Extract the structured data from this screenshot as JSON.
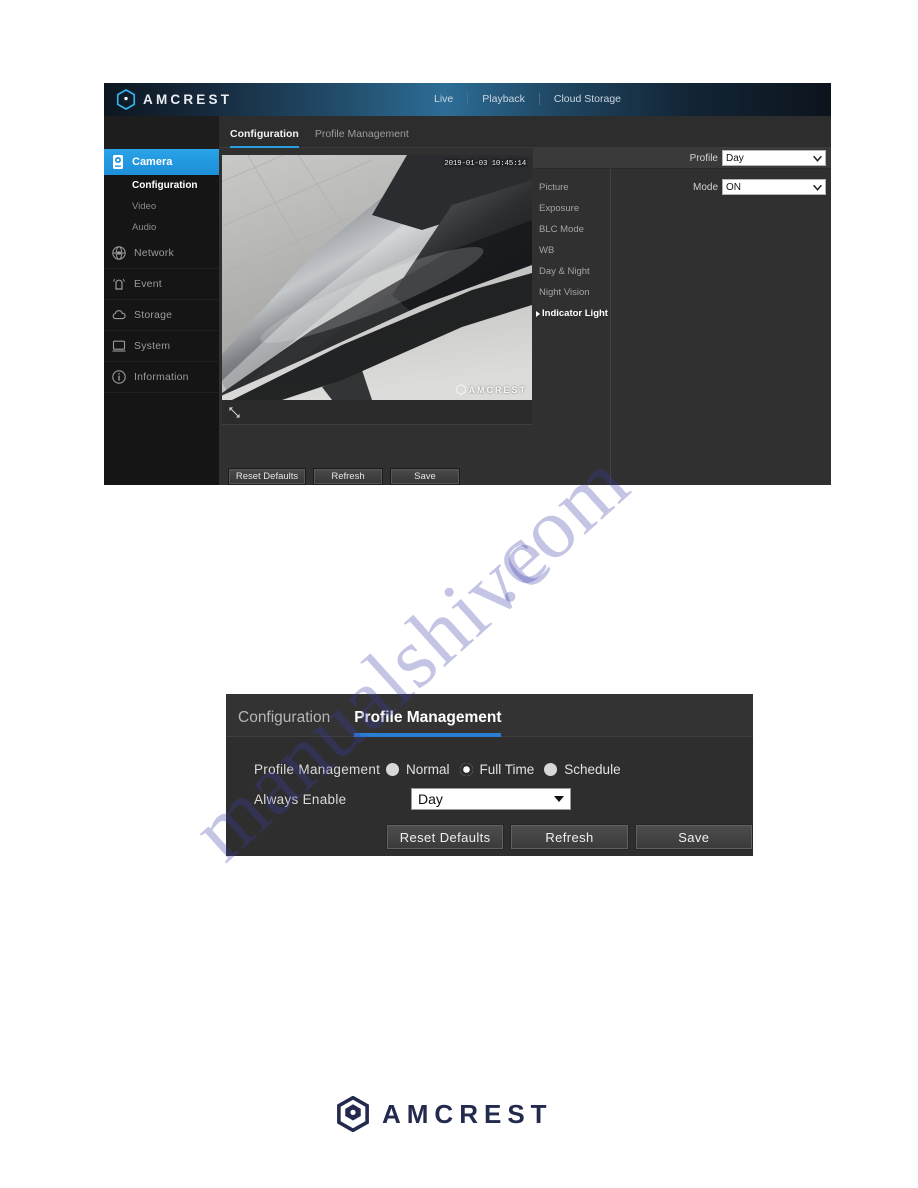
{
  "figure1": {
    "brand": "AMCREST",
    "brand_icon": "amcrest-hex-logo-icon",
    "topnav": [
      {
        "label": "Live"
      },
      {
        "label": "Playback"
      },
      {
        "label": "Cloud Storage"
      }
    ],
    "sidebar": {
      "active": {
        "label": "Camera",
        "icon": "camera-icon"
      },
      "sub_items": [
        {
          "label": "Configuration",
          "current": true
        },
        {
          "label": "Video",
          "current": false
        },
        {
          "label": "Audio",
          "current": false
        }
      ],
      "items": [
        {
          "label": "Network",
          "icon": "globe-network-icon"
        },
        {
          "label": "Event",
          "icon": "alarm-bell-icon"
        },
        {
          "label": "Storage",
          "icon": "cloud-storage-icon"
        },
        {
          "label": "System",
          "icon": "monitor-system-icon"
        },
        {
          "label": "Information",
          "icon": "info-circle-icon"
        }
      ]
    },
    "tabs": [
      {
        "label": "Configuration",
        "active": true
      },
      {
        "label": "Profile Management",
        "active": false
      }
    ],
    "video": {
      "timestamp": "2019-01-03 10:45:14",
      "overlay_logo": "AMCREST",
      "overlay_logo_icon": "amcrest-hex-logo-icon",
      "expand_icon": "expand-fullscreen-icon"
    },
    "profile_field": {
      "label": "Profile",
      "value": "Day",
      "icon": "chevron-down-icon"
    },
    "sub_menu": [
      {
        "label": "Picture",
        "selected": false
      },
      {
        "label": "Exposure",
        "selected": false
      },
      {
        "label": "BLC Mode",
        "selected": false
      },
      {
        "label": "WB",
        "selected": false
      },
      {
        "label": "Day & Night",
        "selected": false
      },
      {
        "label": "Night Vision",
        "selected": false
      },
      {
        "label": "Indicator Light",
        "selected": true
      }
    ],
    "mode_field": {
      "label": "Mode",
      "value": "ON",
      "icon": "chevron-down-icon"
    },
    "buttons": [
      {
        "label": "Reset Defaults"
      },
      {
        "label": "Refresh"
      },
      {
        "label": "Save"
      }
    ]
  },
  "figure2": {
    "tabs": [
      {
        "label": "Configuration",
        "active": false
      },
      {
        "label": "Profile Management",
        "active": true
      }
    ],
    "profile_management": {
      "label": "Profile Management",
      "options": [
        {
          "label": "Normal",
          "selected": false
        },
        {
          "label": "Full Time",
          "selected": true
        },
        {
          "label": "Schedule",
          "selected": false
        }
      ]
    },
    "always_enable": {
      "label": "Always Enable",
      "value": "Day",
      "icon": "triangle-down-icon"
    },
    "buttons": [
      {
        "label": "Reset Defaults"
      },
      {
        "label": "Refresh"
      },
      {
        "label": "Save"
      }
    ]
  },
  "footer": {
    "brand": "AMCREST",
    "brand_icon": "amcrest-hex-logo-icon"
  },
  "watermark": {
    "line1": "manualshive",
    "line2": ".com"
  },
  "colors": {
    "accent_blue": "#2a9fe0",
    "header_blue": "#2d6d97",
    "panel_dark": "#2b2b2b",
    "sidebar_dark": "#151515",
    "brand_navy": "#232a4e"
  }
}
